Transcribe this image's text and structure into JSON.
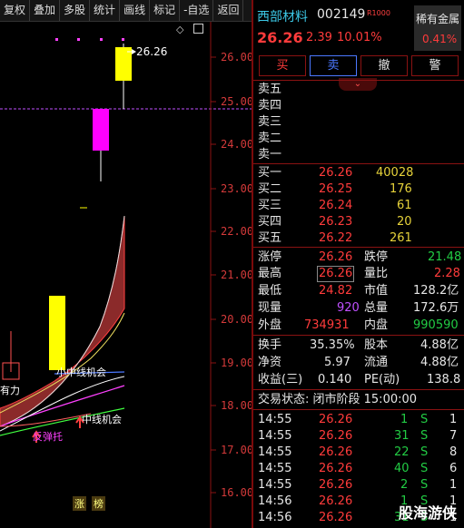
{
  "toolbar": {
    "items": [
      "复权",
      "叠加",
      "多股",
      "统计",
      "画线",
      "标记",
      "-自选",
      "返回"
    ]
  },
  "chart": {
    "y_ticks": [
      "26.00",
      "25.00",
      "24.00",
      "23.00",
      "22.00",
      "21.00",
      "20.00",
      "19.00",
      "18.00",
      "17.00",
      "16.00"
    ],
    "high_label": "26.26",
    "annotations": {
      "mid_line_chance_1": "小中线机会",
      "mid_line_chance_2": "中线机会",
      "rebound_support": "反弹托",
      "power": "有力"
    },
    "markers": [
      "涨",
      "榜"
    ],
    "corner_icon": "diamond-icon"
  },
  "stock": {
    "name": "西部材料",
    "code": "002149",
    "tag": "R1000",
    "price": "26.26",
    "change": "2.39",
    "change_pct": "10.01%",
    "sector_name": "稀有金属",
    "sector_pct": "0.41%"
  },
  "trade_buttons": [
    "买",
    "卖",
    "撤",
    "警"
  ],
  "asks": [
    {
      "label": "卖五",
      "price": "",
      "vol": ""
    },
    {
      "label": "卖四",
      "price": "",
      "vol": ""
    },
    {
      "label": "卖三",
      "price": "",
      "vol": ""
    },
    {
      "label": "卖二",
      "price": "",
      "vol": ""
    },
    {
      "label": "卖一",
      "price": "",
      "vol": ""
    }
  ],
  "bids": [
    {
      "label": "买一",
      "price": "26.26",
      "vol": "40028"
    },
    {
      "label": "买二",
      "price": "26.25",
      "vol": "176"
    },
    {
      "label": "买三",
      "price": "26.24",
      "vol": "61"
    },
    {
      "label": "买四",
      "price": "26.23",
      "vol": "20"
    },
    {
      "label": "买五",
      "price": "26.22",
      "vol": "261"
    }
  ],
  "stats": [
    {
      "l1": "涨停",
      "v1": "26.26",
      "l2": "跌停",
      "v2": "21.48"
    },
    {
      "l1": "最高",
      "v1": "26.26",
      "l2": "量比",
      "v2": "2.28"
    },
    {
      "l1": "最低",
      "v1": "24.82",
      "l2": "市值",
      "v2": "128.2亿"
    },
    {
      "l1": "现量",
      "v1": "920",
      "l2": "总量",
      "v2": "172.6万"
    },
    {
      "l1": "外盘",
      "v1": "734931",
      "l2": "内盘",
      "v2": "990590"
    }
  ],
  "stats2": [
    {
      "l1": "换手",
      "v1": "35.35%",
      "l2": "股本",
      "v2": "4.88亿"
    },
    {
      "l1": "净资",
      "v1": "5.97",
      "l2": "流通",
      "v2": "4.88亿"
    },
    {
      "l1": "收益(三)",
      "v1": "0.140",
      "l2": "PE(动)",
      "v2": "138.8"
    }
  ],
  "status": "交易状态: 闭市阶段 15:00:00",
  "ticks": [
    {
      "time": "14:55",
      "price": "26.26",
      "vol": "1",
      "side": "S",
      "num": "1"
    },
    {
      "time": "14:55",
      "price": "26.26",
      "vol": "31",
      "side": "S",
      "num": "7"
    },
    {
      "time": "14:55",
      "price": "26.26",
      "vol": "22",
      "side": "S",
      "num": "8"
    },
    {
      "time": "14:55",
      "price": "26.26",
      "vol": "40",
      "side": "S",
      "num": "6"
    },
    {
      "time": "14:55",
      "price": "26.26",
      "vol": "2",
      "side": "S",
      "num": "1"
    },
    {
      "time": "14:56",
      "price": "26.26",
      "vol": "1",
      "side": "S",
      "num": "1"
    },
    {
      "time": "14:56",
      "price": "26.26",
      "vol": "31",
      "side": "S",
      "num": "1"
    }
  ],
  "watermark": "股海游侠"
}
